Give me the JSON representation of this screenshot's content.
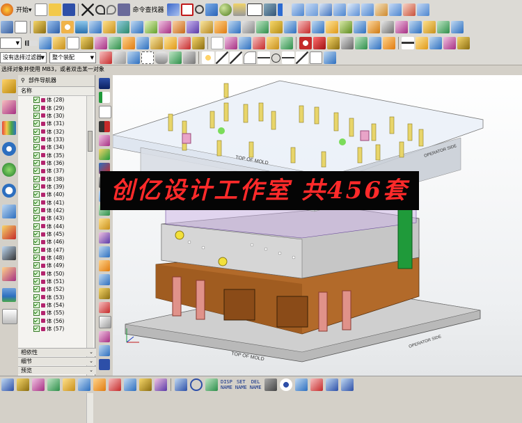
{
  "toolbar": {
    "start_label": "开始▾",
    "command_finder_label": "命令查找器"
  },
  "filters": {
    "type_filter": "没有选择过滤器",
    "assembly_filter": "整个装配"
  },
  "cue_line": "选择对象并使用 MB3，或者双击某一对象",
  "navigator": {
    "title": "部件导航器",
    "column_name": "名称",
    "item_prefix": "体",
    "items": [
      "(28)",
      "(29)",
      "(30)",
      "(31)",
      "(32)",
      "(33)",
      "(34)",
      "(35)",
      "(36)",
      "(37)",
      "(38)",
      "(39)",
      "(40)",
      "(41)",
      "(42)",
      "(43)",
      "(44)",
      "(45)",
      "(46)",
      "(47)",
      "(48)",
      "(49)",
      "(50)",
      "(51)",
      "(52)",
      "(53)",
      "(54)",
      "(55)",
      "(56)",
      "(57)"
    ],
    "panels": [
      {
        "label": "相依性"
      },
      {
        "label": "细节"
      },
      {
        "label": "预览"
      }
    ]
  },
  "viewport": {
    "labels": {
      "top_of_mold": "TOP OF MOLD",
      "operator_side": "OPERATOR SIDE"
    }
  },
  "banner": {
    "text": "创亿设计工作室 共456套"
  },
  "bottom_bar": {
    "disp_name": [
      "DISP",
      "NAME"
    ],
    "set_name": [
      "SET",
      "NAME"
    ],
    "del_name": [
      "DEL",
      "NAME"
    ]
  },
  "colors": {
    "plate_gray": "#b9b9b9",
    "copper": "#b26a2a",
    "pink": "#e0928a",
    "green": "#1f9a3a",
    "pin_yellow": "#e8d56a",
    "banner_red": "#ff2a2a"
  }
}
